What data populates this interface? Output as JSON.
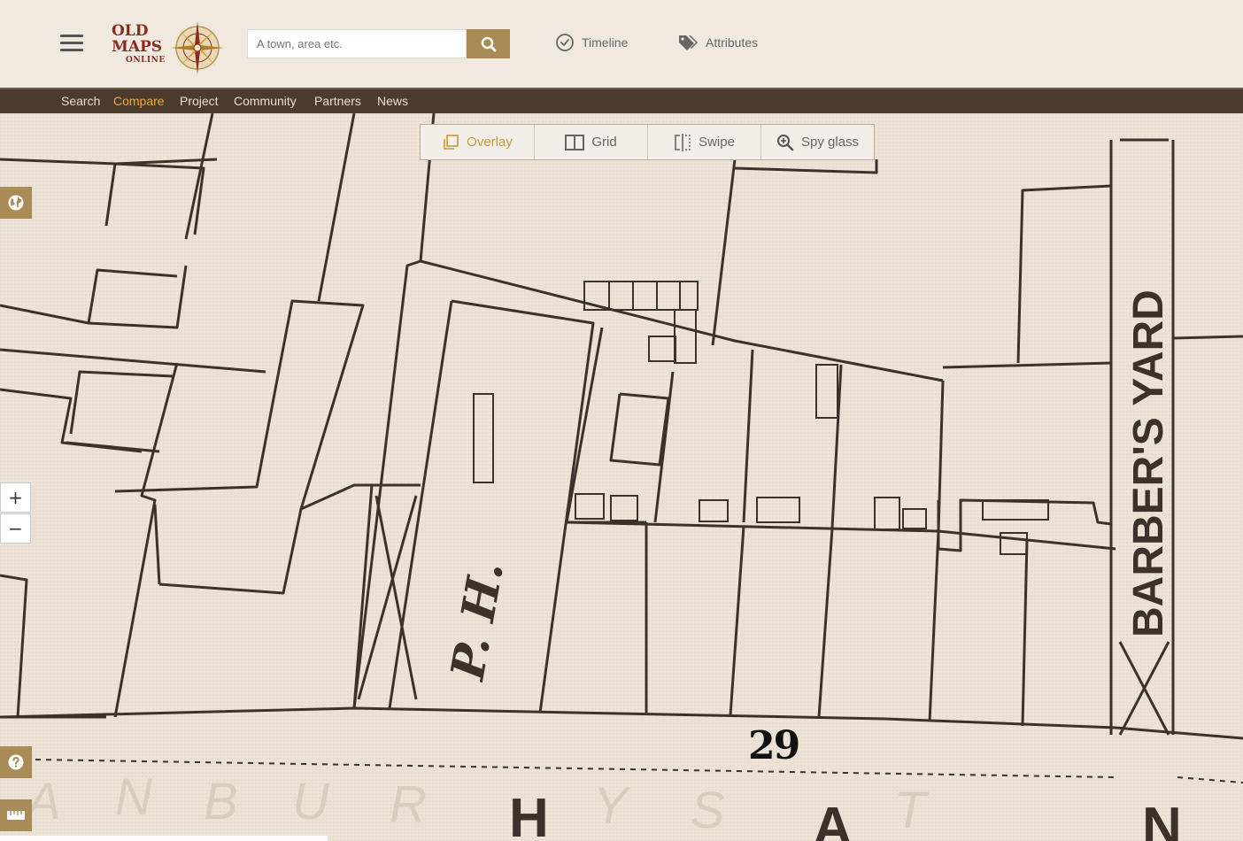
{
  "header": {
    "logo": {
      "line1": "OLD",
      "line2": "MAPS",
      "line3": "ONLINE",
      "icon": "compass-rose-icon"
    },
    "menu_icon": "hamburger-menu-icon",
    "search": {
      "placeholder": "A town, area etc.",
      "value": "",
      "button_icon": "search-icon"
    },
    "links": [
      {
        "label": "Timeline",
        "icon": "clock-check-icon"
      },
      {
        "label": "Attributes",
        "icon": "tags-icon"
      }
    ]
  },
  "nav": {
    "items": [
      "Search",
      "Compare",
      "Project",
      "Community",
      "Partners",
      "News"
    ],
    "active": "Compare",
    "active_color": "#f0a93c"
  },
  "compare_modes": {
    "items": [
      {
        "label": "Overlay",
        "icon": "overlay-icon"
      },
      {
        "label": "Grid",
        "icon": "grid-icon"
      },
      {
        "label": "Swipe",
        "icon": "swipe-icon"
      },
      {
        "label": "Spy glass",
        "icon": "zoom-in-icon"
      }
    ],
    "active": "Overlay"
  },
  "map": {
    "labels": {
      "yard": "BARBER'S YARD",
      "ph": "P. H.",
      "sheet_number": "29",
      "street_letters": [
        "A",
        "N",
        "B",
        "U",
        "R",
        "Y",
        "S",
        "T",
        "H",
        "A",
        "N"
      ]
    },
    "controls": {
      "zoom_in": "+",
      "zoom_out": "−",
      "globe_icon": "globe-icon",
      "help_icon": "help-icon",
      "ruler_icon": "ruler-icon"
    }
  },
  "colors": {
    "accent": "#a98c55",
    "navbar": "#4b3b2c",
    "header_bg": "#efe9e0",
    "map_ink": "#3d3229",
    "paper": "#ece3d6"
  }
}
